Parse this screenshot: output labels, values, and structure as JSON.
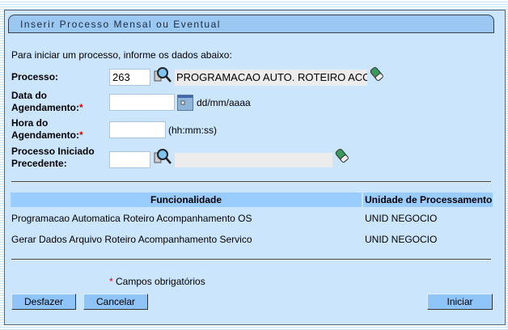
{
  "title": "Inserir Processo Mensal ou Eventual",
  "intro": "Para iniciar um processo, informe os dados abaixo:",
  "form": {
    "processo": {
      "label": "Processo:",
      "value": "263",
      "description": "PROGRAMACAO AUTO. ROTEIRO ACOMPANHAMENTO OS"
    },
    "data": {
      "label_line1": "Data do",
      "label_line2": "Agendamento:",
      "required": "*",
      "value": "",
      "hint": "dd/mm/aaaa"
    },
    "hora": {
      "label_line1": "Hora do",
      "label_line2": "Agendamento:",
      "required": "*",
      "value": "",
      "hint": "(hh:mm:ss)"
    },
    "precedente": {
      "label_line1": "Processo Iniciado",
      "label_line2": "Precedente:",
      "value": "",
      "description": ""
    }
  },
  "table": {
    "headers": [
      "Funcionalidade",
      "Unidade de Processamento"
    ],
    "rows": [
      [
        "Programacao Automatica Roteiro Acompanhamento OS",
        "UNID NEGOCIO"
      ],
      [
        "Gerar Dados Arquivo Roteiro Acompanhamento Servico",
        "UNID NEGOCIO"
      ]
    ]
  },
  "required_note": {
    "star": "*",
    "text": " Campos obrigatórios"
  },
  "buttons": {
    "undo": "Desfazer",
    "cancel": "Cancelar",
    "start": "Iniciar"
  }
}
